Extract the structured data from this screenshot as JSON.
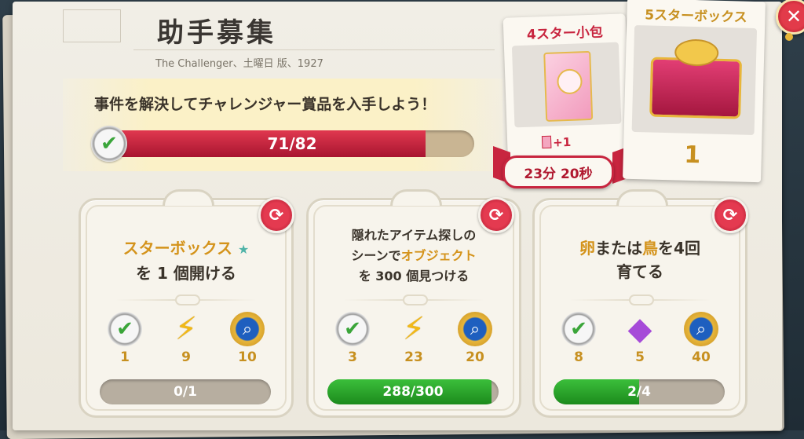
{
  "header": {
    "title": "助手募集",
    "subtitle": "The Challenger、土曜日 版、1927"
  },
  "banner": {
    "text": "事件を解決してチャレンジャー賞品を入手しよう！",
    "progress_current": 71,
    "progress_total": 82,
    "progress_label": "71/82"
  },
  "rewards": {
    "small": {
      "title": "4スター小包",
      "bonus": "+1",
      "timer": "23分 20秒"
    },
    "big": {
      "title": "5スターボックス",
      "count": "1"
    }
  },
  "quests": [
    {
      "line1_hl": "スターボックス",
      "line2": "を 1 個開ける",
      "rewards": [
        {
          "icon": "check-badge-icon",
          "value": "1"
        },
        {
          "icon": "lightning-icon",
          "value": "9"
        },
        {
          "icon": "magnifier-medal-icon",
          "value": "10"
        }
      ],
      "progress_label": "0/1",
      "progress_fraction": 0.0
    },
    {
      "line1": "隠れたアイテム探しの",
      "line2_a": "シーンで",
      "line2_hl": "オブジェクト",
      "line3": "を 300 個見つける",
      "rewards": [
        {
          "icon": "check-badge-icon",
          "value": "3"
        },
        {
          "icon": "lightning-icon",
          "value": "23"
        },
        {
          "icon": "magnifier-medal-icon",
          "value": "20"
        }
      ],
      "progress_label": "288/300",
      "progress_fraction": 0.96
    },
    {
      "hl1": "卵",
      "mid": "または",
      "hl2": "鳥",
      "tail": "を4回",
      "line2": "育てる",
      "rewards": [
        {
          "icon": "check-badge-icon",
          "value": "8"
        },
        {
          "icon": "gem-icon",
          "value": "5"
        },
        {
          "icon": "magnifier-medal-icon",
          "value": "40"
        }
      ],
      "progress_label": "2/4",
      "progress_fraction": 0.5
    }
  ],
  "colors": {
    "accent_red": "#c8253f",
    "gold": "#c79020",
    "progress_green": "#2aa52a"
  }
}
